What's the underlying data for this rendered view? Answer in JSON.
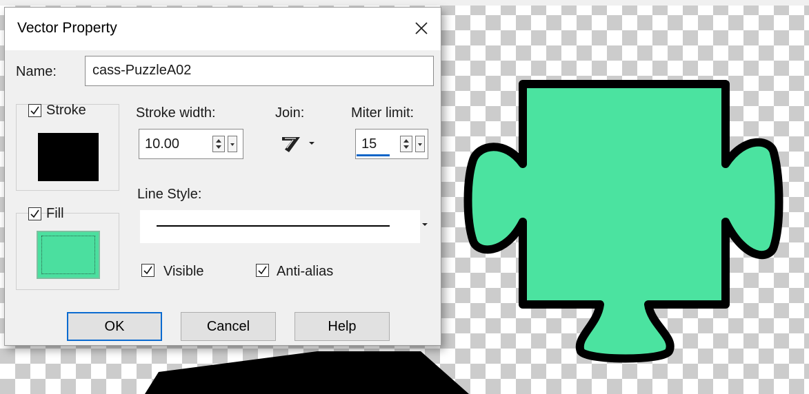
{
  "dialog": {
    "title": "Vector Property",
    "name_label": "Name:",
    "name_value": "cass-PuzzleA02",
    "stroke": {
      "label": "Stroke",
      "checked": true,
      "color": "#000000"
    },
    "fill": {
      "label": "Fill",
      "checked": true,
      "color": "#4bdf9f"
    },
    "stroke_width": {
      "label": "Stroke width:",
      "value": "10.00"
    },
    "join": {
      "label": "Join:"
    },
    "miter_limit": {
      "label": "Miter limit:",
      "value": "15"
    },
    "line_style": {
      "label": "Line Style:"
    },
    "visible": {
      "label": "Visible",
      "checked": true
    },
    "anti_alias": {
      "label": "Anti-alias",
      "checked": true
    },
    "buttons": {
      "ok": "OK",
      "cancel": "Cancel",
      "help": "Help"
    }
  },
  "canvas": {
    "shape_fill": "#4be3a0",
    "shape_stroke": "#000000"
  }
}
